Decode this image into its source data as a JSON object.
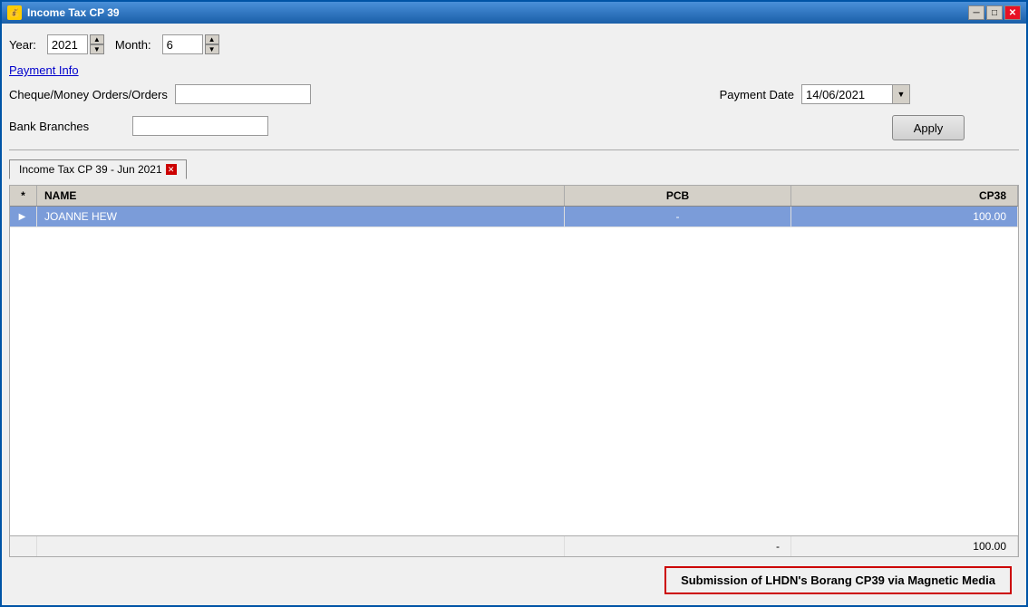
{
  "window": {
    "title": "Income Tax CP 39",
    "icon": "💰"
  },
  "controls": {
    "year_label": "Year:",
    "year_value": "2021",
    "month_label": "Month:",
    "month_value": "6"
  },
  "payment": {
    "section_title": "Payment Info",
    "cheque_label": "Cheque/Money Orders/Orders",
    "cheque_value": "",
    "payment_date_label": "Payment Date",
    "payment_date_value": "14/06/2021",
    "bank_branches_label": "Bank Branches",
    "bank_branches_value": "",
    "apply_label": "Apply"
  },
  "tab": {
    "label": "Income Tax CP 39 - Jun 2021"
  },
  "table": {
    "headers": {
      "star": "*",
      "name": "NAME",
      "pcb": "PCB",
      "cp38": "CP38"
    },
    "rows": [
      {
        "selected": true,
        "arrow": "▶",
        "name": "JOANNE HEW",
        "pcb": "-",
        "cp38": "100.00"
      }
    ],
    "footer": {
      "pcb": "-",
      "cp38": "100.00"
    }
  },
  "submission_button": "Submission of LHDN's Borang CP39 via Magnetic Media",
  "title_buttons": {
    "minimize": "─",
    "maximize": "□",
    "close": "✕"
  }
}
